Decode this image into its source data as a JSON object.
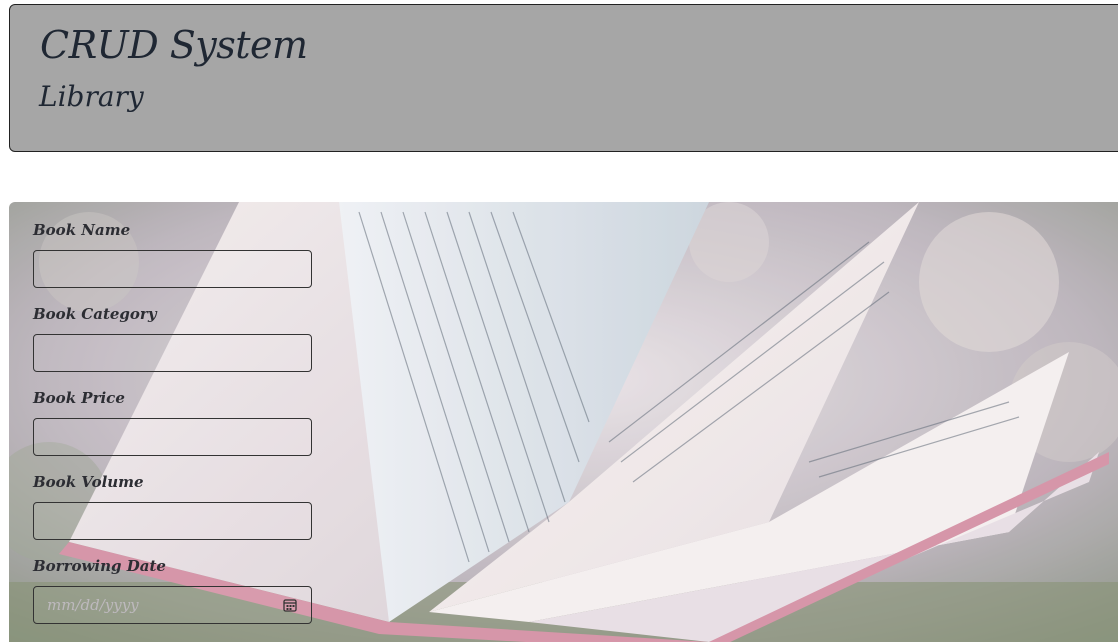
{
  "header": {
    "title": "CRUD System",
    "subtitle": "Library"
  },
  "form": {
    "fields": [
      {
        "label": "Book Name",
        "value": "",
        "placeholder": ""
      },
      {
        "label": "Book Category",
        "value": "",
        "placeholder": ""
      },
      {
        "label": "Book Price",
        "value": "",
        "placeholder": ""
      },
      {
        "label": "Book Volume",
        "value": "",
        "placeholder": ""
      },
      {
        "label": "Borrowing Date",
        "value": "",
        "placeholder": "mm/dd/yyyy"
      }
    ]
  },
  "icons": {
    "date": "calendar-icon"
  },
  "colors": {
    "header_bg": "#a6a6a6",
    "text": "#1f2733"
  }
}
